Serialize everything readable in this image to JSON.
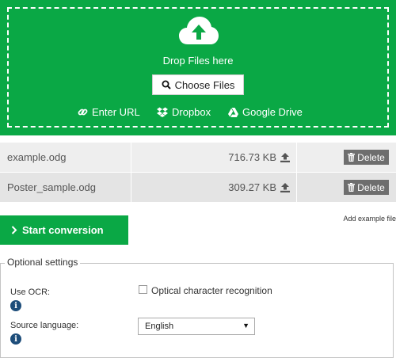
{
  "upload": {
    "drop_text": "Drop Files here",
    "choose_label": "Choose Files",
    "sources": [
      {
        "label": "Enter URL",
        "icon": "link-icon"
      },
      {
        "label": "Dropbox",
        "icon": "dropbox-icon"
      },
      {
        "label": "Google Drive",
        "icon": "google-drive-icon"
      }
    ]
  },
  "files": [
    {
      "name": "example.odg",
      "size": "716.73 KB",
      "delete_label": "Delete"
    },
    {
      "name": "Poster_sample.odg",
      "size": "309.27 KB",
      "delete_label": "Delete"
    }
  ],
  "actions": {
    "start_label": "Start conversion",
    "add_example_label": "Add example file"
  },
  "settings": {
    "legend": "Optional settings",
    "ocr_label": "Use OCR:",
    "ocr_checkbox_label": "Optical character recognition",
    "ocr_checked": false,
    "source_language_label": "Source language:",
    "source_language_value": "English"
  },
  "colors": {
    "brand_green": "#0aa845",
    "delete_gray": "#6e6e6e",
    "info_blue": "#1d4d7a"
  }
}
